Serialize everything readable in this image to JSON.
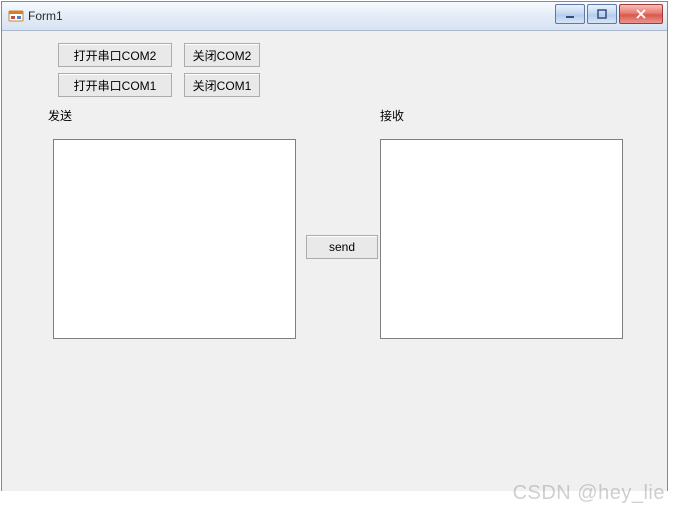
{
  "window": {
    "title": "Form1"
  },
  "buttons": {
    "open_com2": "打开串口COM2",
    "close_com2": "关闭COM2",
    "open_com1": "打开串口COM1",
    "close_com1": "关闭COM1",
    "send": "send"
  },
  "labels": {
    "send": "发送",
    "receive": "接收"
  },
  "textboxes": {
    "send_value": "",
    "receive_value": ""
  },
  "watermark": "CSDN @hey_lie"
}
